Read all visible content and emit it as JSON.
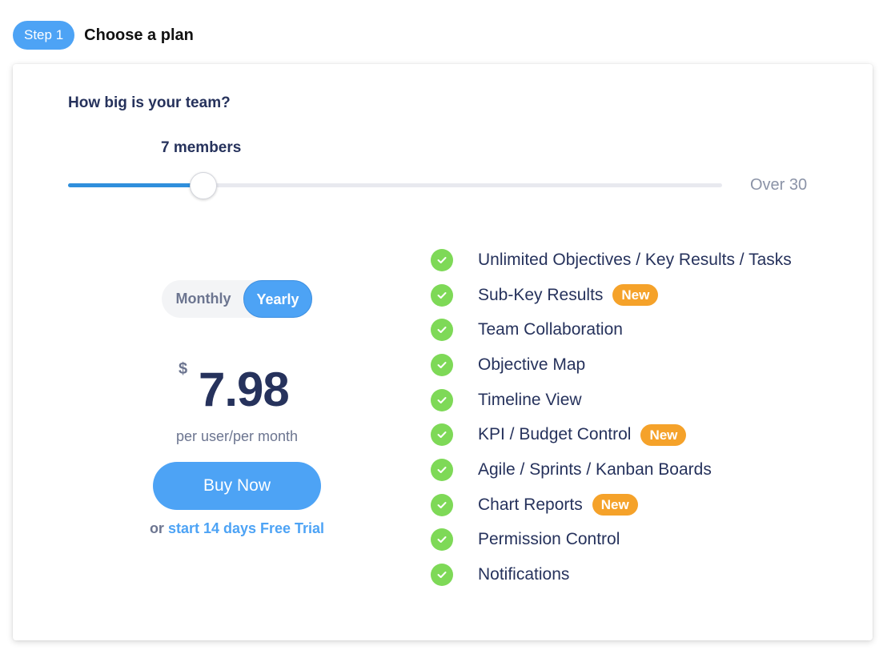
{
  "step": {
    "badge": "Step 1",
    "title": "Choose a plan"
  },
  "team": {
    "question": "How big is your team?",
    "members_label": "7 members",
    "slider": {
      "value": 7,
      "min": 1,
      "max": 30,
      "max_label": "Over 30"
    }
  },
  "billing": {
    "options": [
      {
        "label": "Monthly",
        "selected": false
      },
      {
        "label": "Yearly",
        "selected": true
      }
    ]
  },
  "price": {
    "currency": "$",
    "amount": "7.98",
    "unit": "per user/per month"
  },
  "cta": {
    "buy_label": "Buy Now",
    "trial_prefix": "or",
    "trial_link": "start 14 days Free Trial"
  },
  "features": [
    {
      "label": "Unlimited Objectives / Key Results / Tasks",
      "badge": null
    },
    {
      "label": "Sub-Key Results",
      "badge": "New"
    },
    {
      "label": "Team Collaboration",
      "badge": null
    },
    {
      "label": "Objective Map",
      "badge": null
    },
    {
      "label": "Timeline View",
      "badge": null
    },
    {
      "label": "KPI / Budget Control",
      "badge": "New"
    },
    {
      "label": "Agile / Sprints / Kanban Boards",
      "badge": null
    },
    {
      "label": "Chart Reports",
      "badge": "New"
    },
    {
      "label": "Permission Control",
      "badge": null
    },
    {
      "label": "Notifications",
      "badge": null
    }
  ],
  "colors": {
    "accent": "#4da3f5",
    "slider_fill": "#2f8fdc",
    "check": "#7ed957",
    "new_badge": "#f5a22a",
    "text_primary": "#26325c",
    "text_muted": "#6c7590"
  }
}
